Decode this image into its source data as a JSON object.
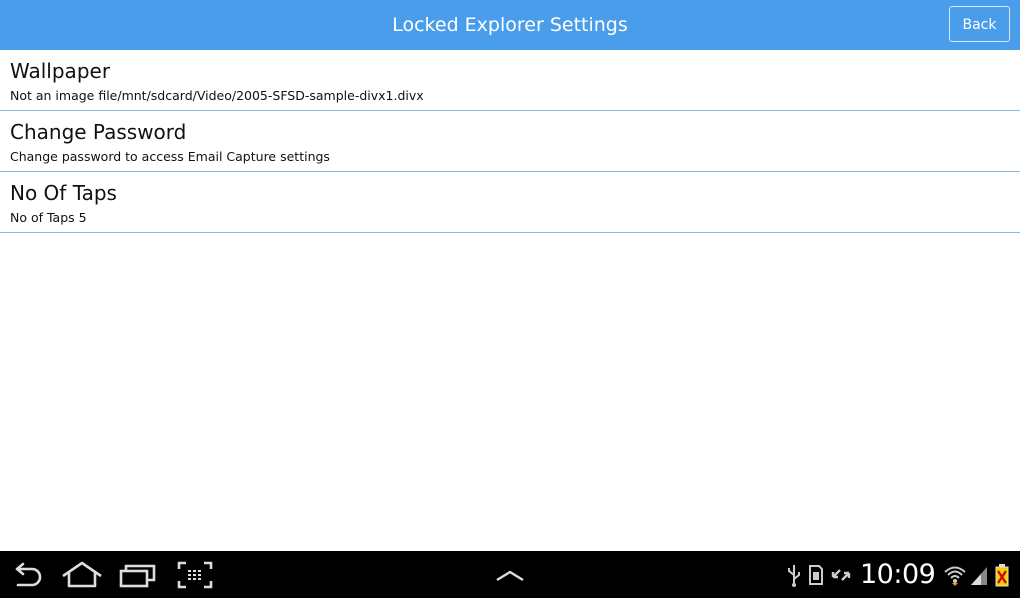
{
  "header": {
    "title": "Locked Explorer Settings",
    "back_label": "Back"
  },
  "settings": [
    {
      "title": "Wallpaper",
      "subtitle": "Not an image file/mnt/sdcard/Video/2005-SFSD-sample-divx1.divx"
    },
    {
      "title": "Change Password",
      "subtitle": "Change password to access Email Capture settings"
    },
    {
      "title": "No Of Taps",
      "subtitle": "No of Taps 5"
    }
  ],
  "system_bar": {
    "time": "10:09",
    "nav_icons": [
      "back-icon",
      "home-icon",
      "recent-apps-icon",
      "screenshot-icon",
      "expand-up-icon"
    ],
    "status_icons": [
      "usb-icon",
      "sd-card-icon",
      "sync-icon",
      "wifi-icon",
      "signal-icon",
      "battery-icon"
    ]
  },
  "colors": {
    "header_bg": "#4a9deb",
    "divider": "#8db9e2",
    "nav_bg": "#000000"
  }
}
